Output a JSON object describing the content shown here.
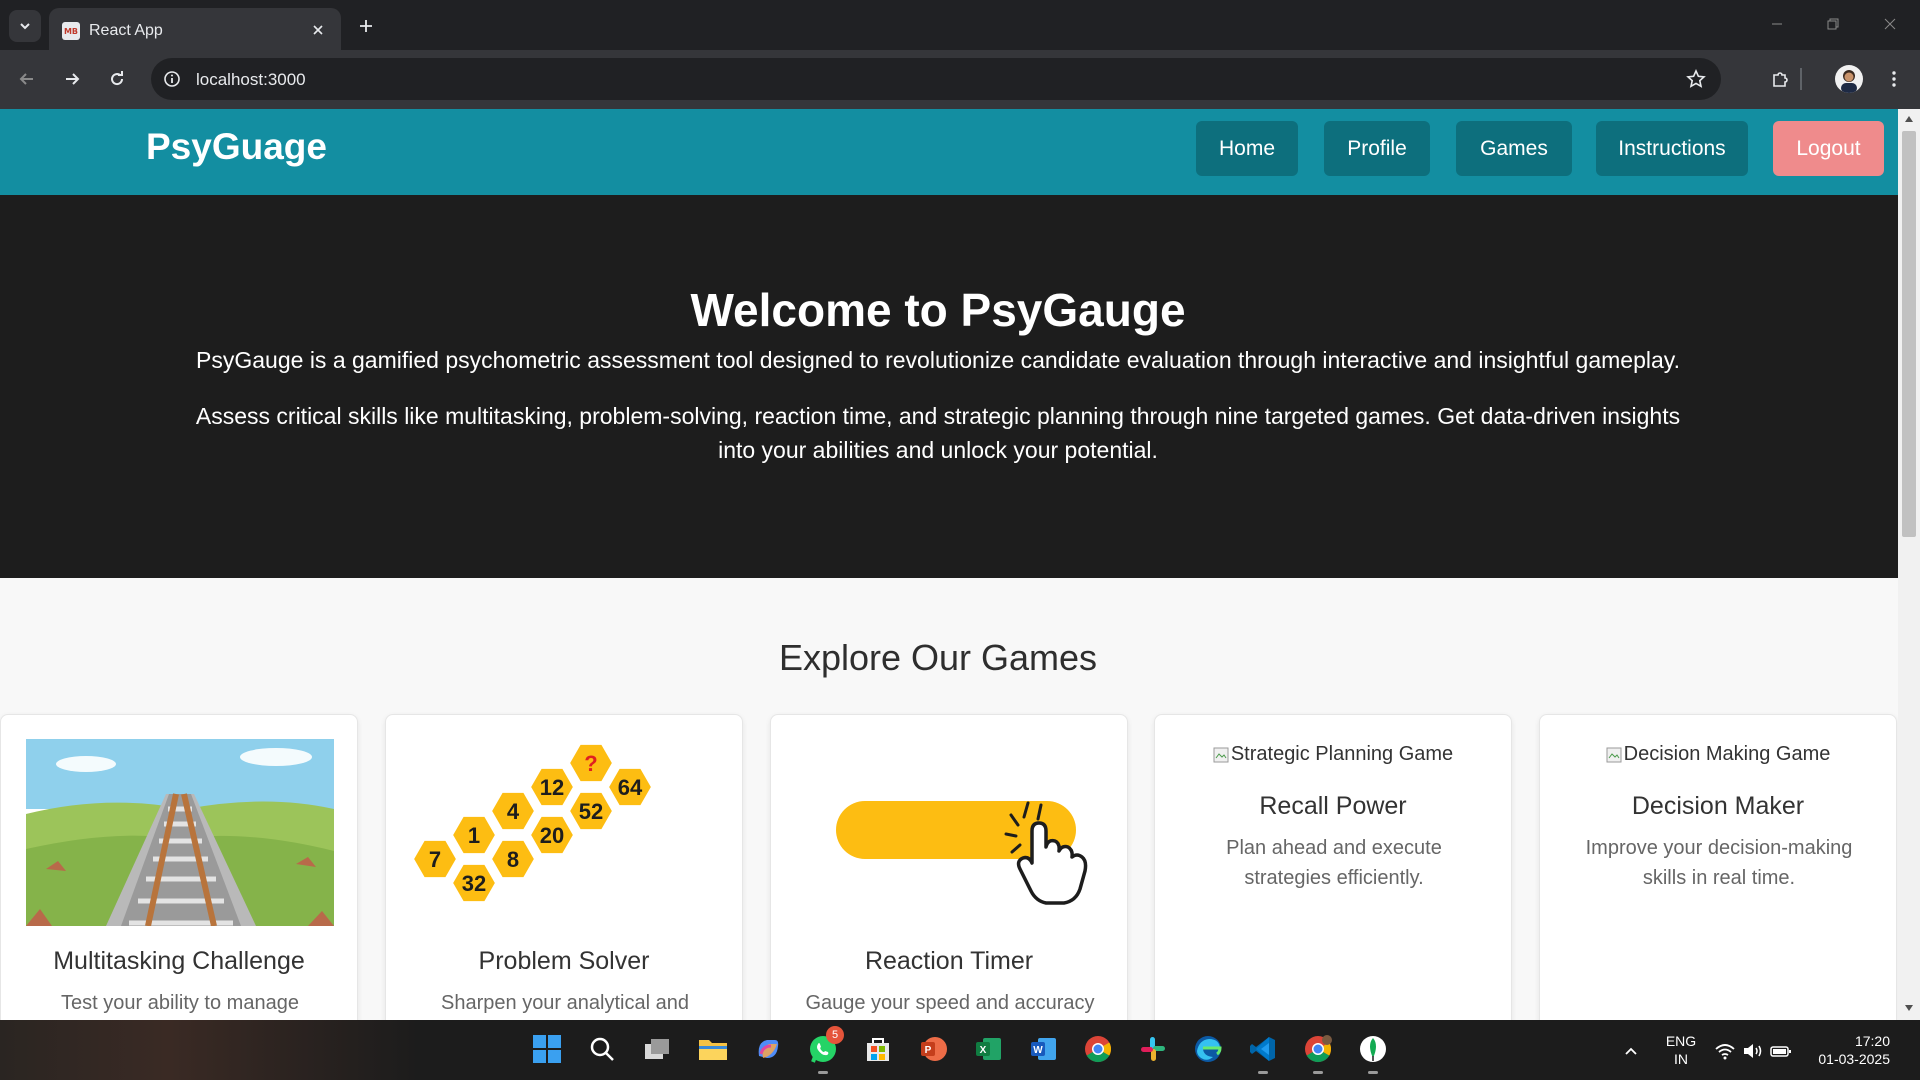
{
  "browser": {
    "tab_title": "React App",
    "tab_favicon_text": "MB",
    "url": "localhost:3000"
  },
  "site": {
    "brand": "PsyGuage",
    "nav": {
      "home": "Home",
      "profile": "Profile",
      "games": "Games",
      "instructions": "Instructions",
      "logout": "Logout"
    },
    "colors": {
      "navbar": "#138ea1",
      "nav_button": "#0d6f7d",
      "logout_button": "#ef8b8c",
      "hero_bg": "#1d1d1d"
    }
  },
  "hero": {
    "title": "Welcome to PsyGauge",
    "paragraph1": "PsyGauge is a gamified psychometric assessment tool designed to revolutionize candidate evaluation through interactive and insightful gameplay.",
    "paragraph2": "Assess critical skills like multitasking, problem-solving, reaction time, and strategic planning through nine targeted games. Get data-driven insights into your abilities and unlock your potential."
  },
  "games": {
    "heading": "Explore Our Games",
    "cards": [
      {
        "title": "Multitasking Challenge",
        "description": "Test your ability to manage",
        "image": "railway-track-illustration"
      },
      {
        "title": "Problem Solver",
        "description": "Sharpen your analytical and",
        "image": "hexagon-number-puzzle",
        "hex_numbers": [
          "?",
          "64",
          "12",
          "52",
          "4",
          "20",
          "1",
          "8",
          "7",
          "32"
        ]
      },
      {
        "title": "Reaction Timer",
        "description": "Gauge your speed and accuracy",
        "image": "tap-button-hand-icon"
      },
      {
        "title": "Recall Power",
        "description": "Plan ahead and execute strategies efficiently.",
        "image_alt": "Strategic Planning Game"
      },
      {
        "title": "Decision Maker",
        "description": "Improve your decision-making skills in real time.",
        "image_alt": "Decision Making Game"
      }
    ]
  },
  "taskbar": {
    "apps": [
      "windows-start",
      "search",
      "task-view",
      "file-explorer",
      "copilot",
      "whatsapp",
      "microsoft-store",
      "powerpoint",
      "excel",
      "word",
      "chrome",
      "slack",
      "edge",
      "vscode",
      "chrome-profile",
      "mongodb-compass"
    ],
    "whatsapp_badge": "5",
    "language_line1": "ENG",
    "language_line2": "IN",
    "time": "17:20",
    "date": "01-03-2025"
  }
}
